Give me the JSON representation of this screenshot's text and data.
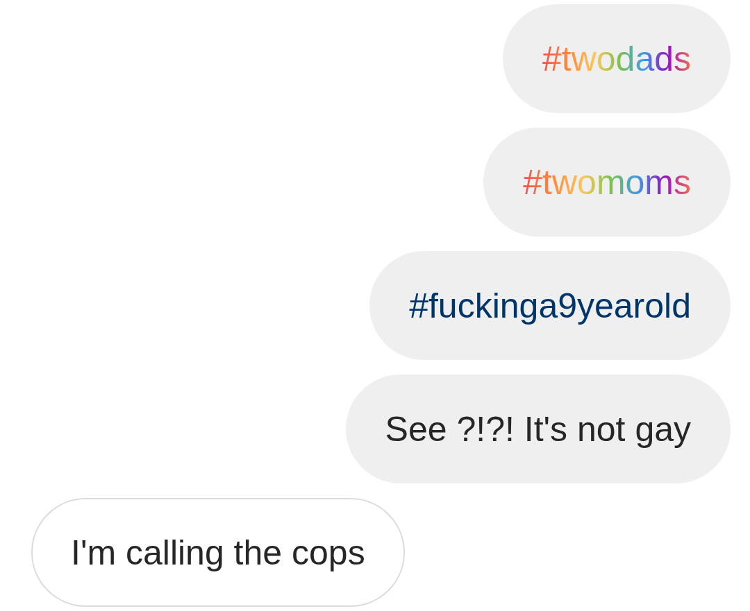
{
  "messages": [
    {
      "text": "#twodads",
      "outgoing": true,
      "kind": "rainbow"
    },
    {
      "text": "#twomoms",
      "outgoing": true,
      "kind": "rainbow"
    },
    {
      "text": "#fuckinga9yearold",
      "outgoing": true,
      "kind": "hashtag"
    },
    {
      "text": "See ?!?! It's not gay",
      "outgoing": true,
      "kind": "plain"
    },
    {
      "text": "I'm calling the cops",
      "outgoing": false,
      "kind": "plain"
    }
  ]
}
